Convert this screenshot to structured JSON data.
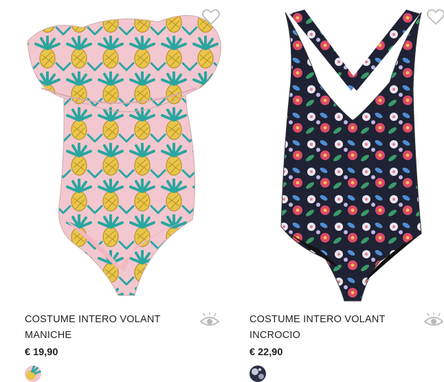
{
  "products": [
    {
      "title_line1": "COSTUME INTERO VOLANT",
      "title_line2": "MANICHE",
      "price": "€ 19,90",
      "wishlist_icon": "heart-outline-icon",
      "quickview_icon": "eye-icon",
      "swatch_colors": [
        "#e9c64a",
        "#2aa6a0"
      ]
    },
    {
      "title_line1": "COSTUME INTERO VOLANT",
      "title_line2": "INCROCIO",
      "price": "€ 22,90",
      "wishlist_icon": "heart-outline-icon",
      "quickview_icon": "eye-icon",
      "swatch_colors": [
        "#2b2f45",
        "#c8c8d6"
      ]
    }
  ],
  "colors": {
    "text": "#222222",
    "icon_gray": "#b9b9b9",
    "pink_lining": "#f4b7c1",
    "pineapple_yellow": "#e9c64a",
    "leaf_teal": "#2aa6a0",
    "floral_dark": "#1f2233"
  }
}
